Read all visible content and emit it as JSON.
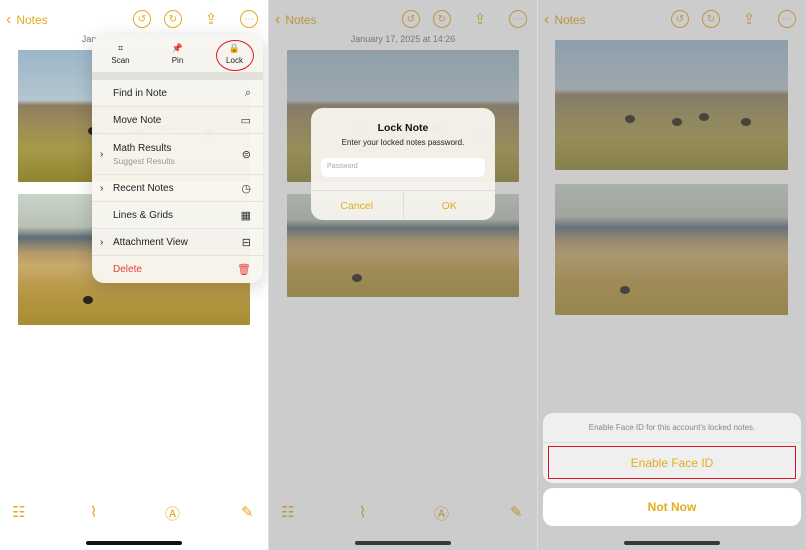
{
  "accent": "#e2ac1e",
  "back_label": "Notes",
  "date": "January 17, 2025 at 14:26",
  "menu": {
    "top": [
      {
        "label": "Scan",
        "icon": "scan-icon"
      },
      {
        "label": "Pin",
        "icon": "pin-icon"
      },
      {
        "label": "Lock",
        "icon": "lock-icon"
      }
    ],
    "rows": [
      {
        "label": "Find in Note",
        "icon": "⌕",
        "chevron": false
      },
      {
        "label": "Move Note",
        "icon": "▭",
        "chevron": false
      },
      {
        "label": "Math Results",
        "sub": "Suggest Results",
        "icon": "⊜",
        "chevron": true
      },
      {
        "label": "Recent Notes",
        "icon": "◷",
        "chevron": true
      },
      {
        "label": "Lines & Grids",
        "icon": "▦",
        "chevron": false
      },
      {
        "label": "Attachment View",
        "icon": "⊟",
        "chevron": true
      },
      {
        "label": "Delete",
        "icon": "🗑",
        "chevron": false,
        "destructive": true
      }
    ]
  },
  "alert": {
    "title": "Lock Note",
    "message": "Enter your locked notes password.",
    "placeholder": "Password",
    "cancel": "Cancel",
    "ok": "OK"
  },
  "sheet": {
    "message": "Enable Face ID for this account's locked notes.",
    "enable": "Enable Face ID",
    "not_now": "Not Now"
  }
}
